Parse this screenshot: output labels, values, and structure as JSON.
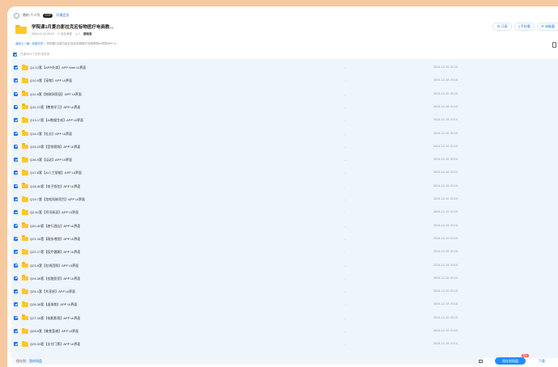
{
  "topbar": {
    "user": "哦的-个人号",
    "vip_badge": "SVIP",
    "vip_link": "开通会员"
  },
  "header": {
    "title": "学院课1月夏白影拉克应标物医疗电商教...",
    "date": "2024-12-19 20:15",
    "expiry": "⊙ 永久有效",
    "views": "◎ 7",
    "owner": "路哈客"
  },
  "actions": {
    "subscribe": "⊕ 订阅",
    "phone": "▯ 手机看",
    "computer": "▣ 电脑看"
  },
  "breadcrumb": {
    "back": "返回上一级",
    "sep1": " | ",
    "all_files": "全部文件",
    "path": " > 学院课1月夏白影拉克应标物医疗电商教育AI学院APP ui..."
  },
  "select_all_label": "已选中61个文件/文件夹",
  "colors": {
    "accent": "#1a73e8",
    "folder": "#fcc82b",
    "save_button": "#1e8efe",
    "badge": "#ff4d4f",
    "list_bg": "#eff5fd"
  },
  "rows": [
    {
      "name": "Q1-12套【APP外卖】APP Web UI界面",
      "size": "-",
      "date": "2024-12-19 20:15"
    },
    {
      "name": "Q10-9套【宠物】APP UI界面",
      "size": "-",
      "date": "2024-12-19 20:15"
    },
    {
      "name": "Q11-9套【物联网家居】APP UI界面",
      "size": "-",
      "date": "2024-12-19 20:15"
    },
    {
      "name": "Q12-21套【教育学习】APP UI界面",
      "size": "-",
      "date": "2024-12-19 20:15"
    },
    {
      "name": "Q13-17套【AI数据生成】APP UI界面",
      "size": "-",
      "date": "2024-12-19 20:15"
    },
    {
      "name": "Q14-2套【社交】APP UI界面",
      "size": "-",
      "date": "2024-12-19 20:15"
    },
    {
      "name": "Q15-23套【音频视频】APP UI界面",
      "size": "-",
      "date": "2024-12-19 20:15"
    },
    {
      "name": "Q16-9套【运动】APP UI界面",
      "size": "-",
      "date": "2024-12-19 20:15"
    },
    {
      "name": "Q17-8套【AI人工智能】APP UI界面",
      "size": "-",
      "date": "2024-12-19 20:15"
    },
    {
      "name": "Q18-40套【电子钱包】APP UI界面",
      "size": "-",
      "date": "2024-12-19 20:15"
    },
    {
      "name": "Q19-7套【游戏机制项目】APP UI界面",
      "size": "-",
      "date": "2024-12-19 20:15"
    },
    {
      "name": "Q2-61套【资讯阅读】APP UI界面",
      "size": "-",
      "date": "2024-12-19 20:15"
    },
    {
      "name": "Q20-40套【旅行酒店】APP UI界面",
      "size": "-",
      "date": "2024-12-19 20:15"
    },
    {
      "name": "Q21-16套【政务地图】APP UI界面",
      "size": "-",
      "date": "2024-12-19 20:15"
    },
    {
      "name": "Q22-17套【医疗健康】APP UI界面",
      "size": "-",
      "date": "2024-12-19 20:15"
    },
    {
      "name": "Q23-9套【在线团购】APP UI界面",
      "size": "-",
      "date": "2024-12-19 20:15"
    },
    {
      "name": "Q24-36套【金融投资】APP UI界面",
      "size": "-",
      "date": "2024-12-19 20:15"
    },
    {
      "name": "Q25-1套【共享经】APP UI界面",
      "size": "-",
      "date": "2024-12-19 20:15"
    },
    {
      "name": "Q26-36套【虚拟物】APP UI界面",
      "size": "-",
      "date": "2024-12-19 20:15"
    },
    {
      "name": "Q27-15套【电影影视】APP UI界面",
      "size": "-",
      "date": "2024-12-19 20:15"
    },
    {
      "name": "Q28-9套【美食菜谱】APP UI界面",
      "size": "-",
      "date": "2024-12-19 20:15"
    },
    {
      "name": "Q29-33套【支付门票】APP UI界面",
      "size": "-",
      "date": "2024-12-19 20:15"
    }
  ],
  "bottombar": {
    "save_to_label": "保存到：",
    "save_path": "我的网盘",
    "save_button": "保存到网盘",
    "badge": "限时",
    "download": "下载"
  }
}
